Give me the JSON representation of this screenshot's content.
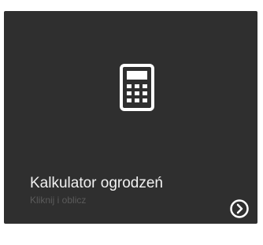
{
  "tile": {
    "title": "Kalkulator ogrodzeń",
    "subtitle": "Kliknij i oblicz",
    "icon": "calculator-icon",
    "action_icon": "chevron-right-circle-icon",
    "background_color": "#2f2f2f"
  }
}
